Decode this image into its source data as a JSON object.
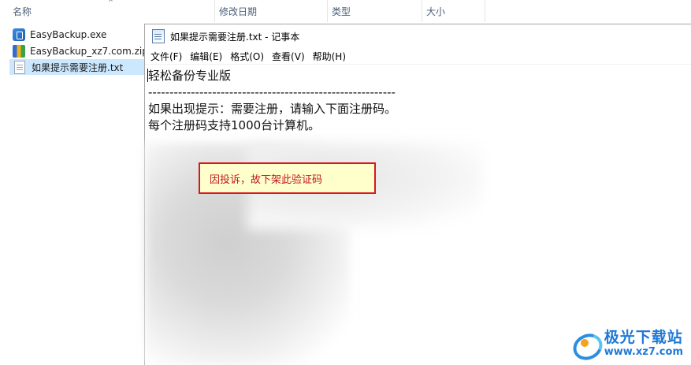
{
  "explorer": {
    "columns": {
      "name": "名称",
      "modified": "修改日期",
      "type": "类型",
      "size": "大小"
    },
    "sort_icon": "chevron-up-icon",
    "files": [
      {
        "name": "EasyBackup.exe",
        "icon": "exe-file-icon",
        "selected": false
      },
      {
        "name": "EasyBackup_xz7.com.zip",
        "icon": "zip-archive-icon",
        "selected": false
      },
      {
        "name": "如果提示需要注册.txt",
        "icon": "text-file-icon",
        "selected": true
      }
    ]
  },
  "notepad": {
    "title": "如果提示需要注册.txt - 记事本",
    "menu": [
      "文件(F)",
      "编辑(E)",
      "格式(O)",
      "查看(V)",
      "帮助(H)"
    ],
    "lines": [
      "轻松备份专业版",
      "----------------------------------------------------------",
      "如果出现提示：需要注册，请输入下面注册码。",
      "每个注册码支持1000台计算机。"
    ],
    "notice": "因投诉，故下架此验证码"
  },
  "watermark": {
    "brand": "极光下载站",
    "url": "www.xz7.com"
  }
}
